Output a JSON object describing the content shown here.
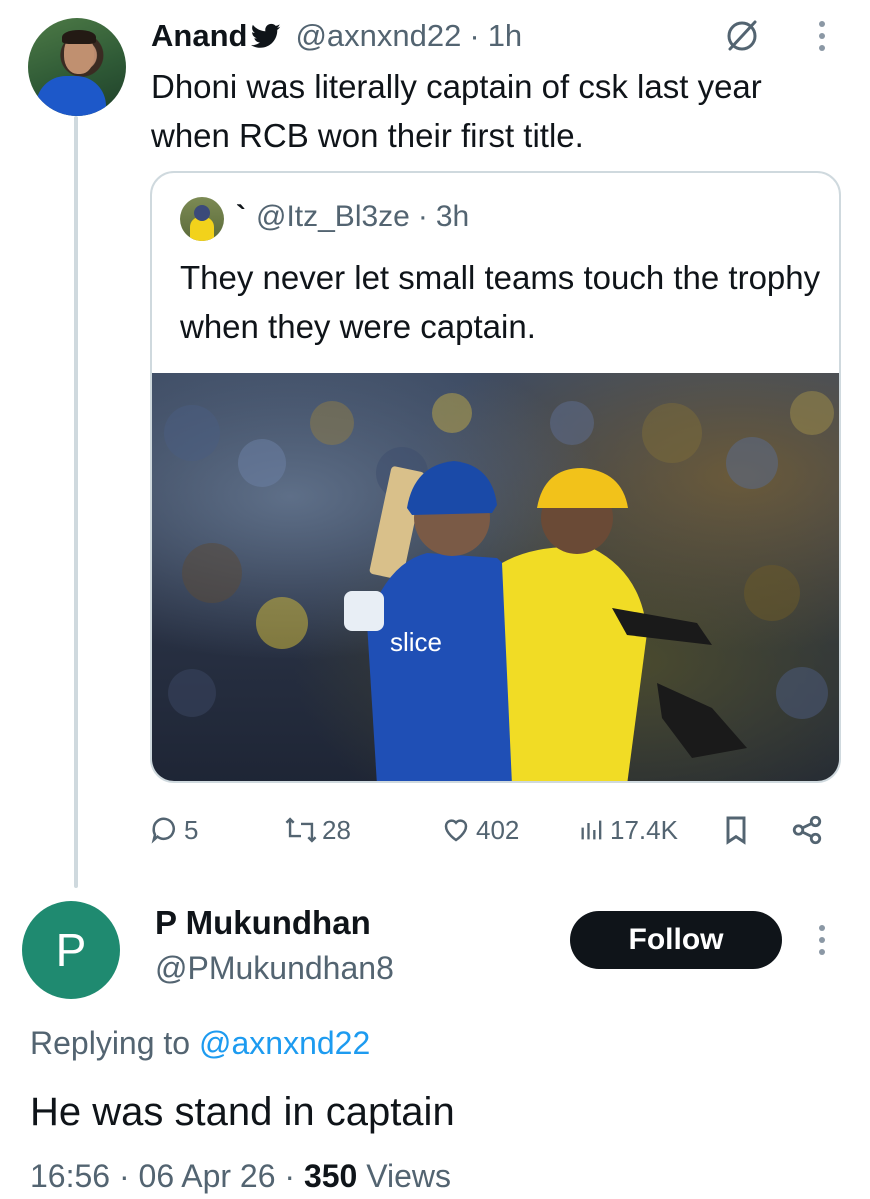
{
  "tweet": {
    "name": "Anand",
    "handle": "@axnxnd22",
    "time": "1h",
    "separator": "·",
    "text": "Dhoni was literally captain of csk last year when RCB won their first title."
  },
  "quoted": {
    "name": "`",
    "handle": "@Itz_Bl3ze",
    "time": "3h",
    "text": "They never let small teams touch the trophy when they were captain.",
    "image_texts": {
      "sponsor": "slice"
    }
  },
  "actions": {
    "replies": "5",
    "retweets": "28",
    "likes": "402",
    "views": "17.4K"
  },
  "reply": {
    "avatar_letter": "P",
    "name": "P Mukundhan",
    "handle": "@PMukundhan8",
    "follow_label": "Follow",
    "replying_prefix": "Replying to",
    "replying_handle": "@axnxnd22",
    "text": "He was stand in captain",
    "time": "16:56",
    "date": "06 Apr 26",
    "views_count": "350",
    "views_label": "Views"
  },
  "colors": {
    "text": "#0f1419",
    "secondary": "#536471",
    "link": "#1d9bf0",
    "avatar_bg": "#1f8a70",
    "button_bg": "#0f1419"
  }
}
